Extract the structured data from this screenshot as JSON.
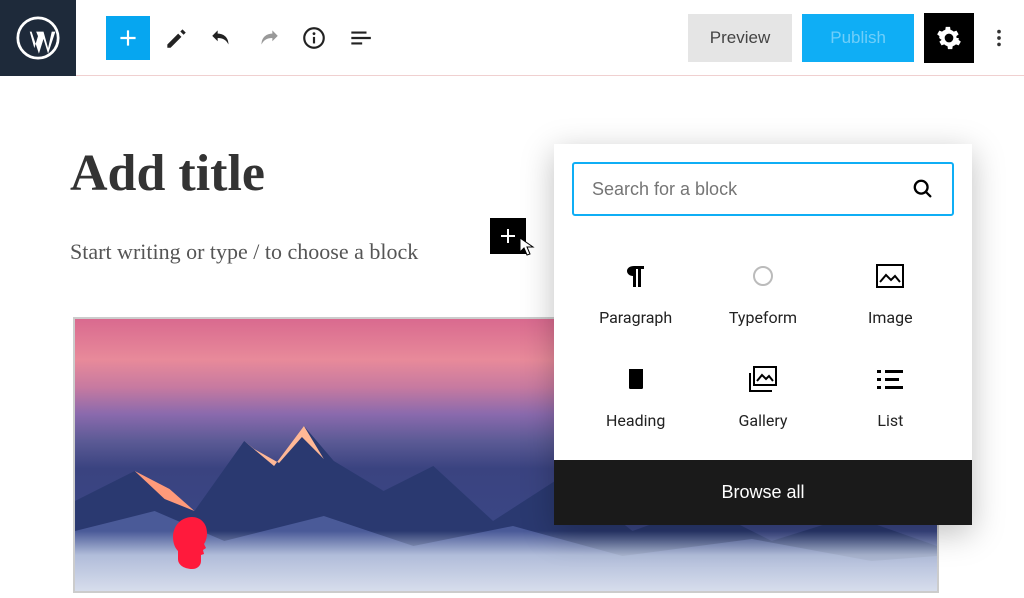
{
  "toolbar": {
    "preview": "Preview",
    "publish": "Publish"
  },
  "editor": {
    "title_placeholder": "Add title",
    "body_placeholder": "Start writing or type / to choose a block"
  },
  "inserter": {
    "search_placeholder": "Search for a block",
    "blocks": [
      {
        "label": "Paragraph"
      },
      {
        "label": "Typeform"
      },
      {
        "label": "Image"
      },
      {
        "label": "Heading"
      },
      {
        "label": "Gallery"
      },
      {
        "label": "List"
      }
    ],
    "browse_all": "Browse all"
  }
}
